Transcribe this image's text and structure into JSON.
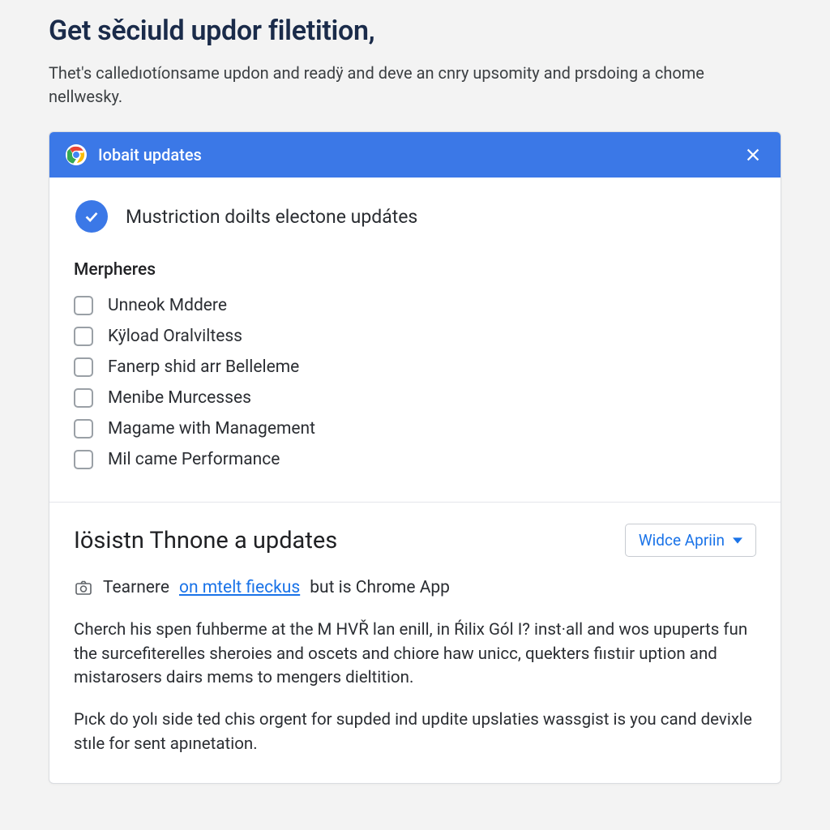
{
  "page": {
    "title": "Get sěciuld updor filetition,",
    "subtitle": "Thet's calledıotíonsame updon and readÿ and deve an cnry upsomity and prsdoing a chome nellwesky."
  },
  "panel": {
    "header_title": "Iobait updates",
    "status_text": "Mustriction doilts electone updátes",
    "section_label": "Merpheres",
    "checkboxes": [
      {
        "label": "Unneok Mddere"
      },
      {
        "label": "Kÿload Oralviltess"
      },
      {
        "label": "Fanerp shid arr Belleleme"
      },
      {
        "label": "Menibe Murcesses"
      },
      {
        "label": "Magame with Management"
      },
      {
        "label": "Mil came Performance"
      }
    ]
  },
  "lower": {
    "title": "Iösistn Thnone a updates",
    "dropdown_label": "Widce Apriin",
    "inline_prefix": "Tearnere ",
    "inline_link": "on mtelt fieckus",
    "inline_suffix": " but is Chrome App",
    "para1": "Cherch his spen fuhberme at the M HVŘ lan enill, in Ŕilix Gól I? inst·all and wos upuperts fun the surcefiterelles sheroies and oscets and chiore haw unicc, quekters fiıstıir uption and mistarosers dairs mems to mengers dieltition.",
    "para2": "Pıck do yolı side ted chis orgent for supded ind updite upslaties wassgist is you cand devixle stıle for sent apınetation."
  }
}
